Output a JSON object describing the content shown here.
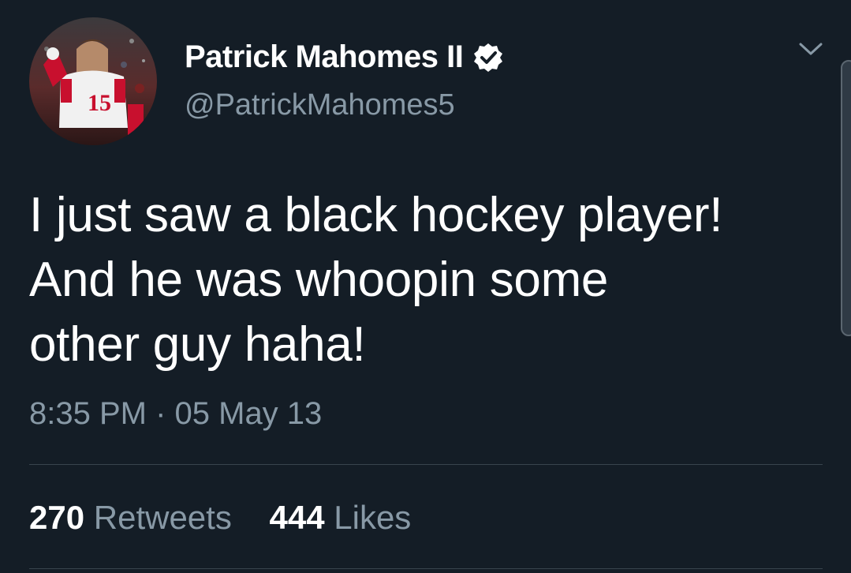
{
  "tweet": {
    "author": {
      "display_name": "Patrick Mahomes II",
      "handle": "@PatrickMahomes5",
      "verified": true,
      "avatar_jersey_number": "15"
    },
    "text_lines": [
      "I just saw a black hockey player!",
      "And he was whoopin some",
      "other guy haha!"
    ],
    "timestamp": "8:35 PM · 05 May 13",
    "stats": {
      "retweets_count": "270",
      "retweets_label": "Retweets",
      "likes_count": "444",
      "likes_label": "Likes"
    }
  },
  "icons": {
    "verified": "verified-badge-icon",
    "menu": "chevron-down-icon"
  },
  "colors": {
    "background": "#141d26",
    "primary_text": "#ffffff",
    "secondary_text": "#8899a6",
    "divider": "#38444d"
  }
}
